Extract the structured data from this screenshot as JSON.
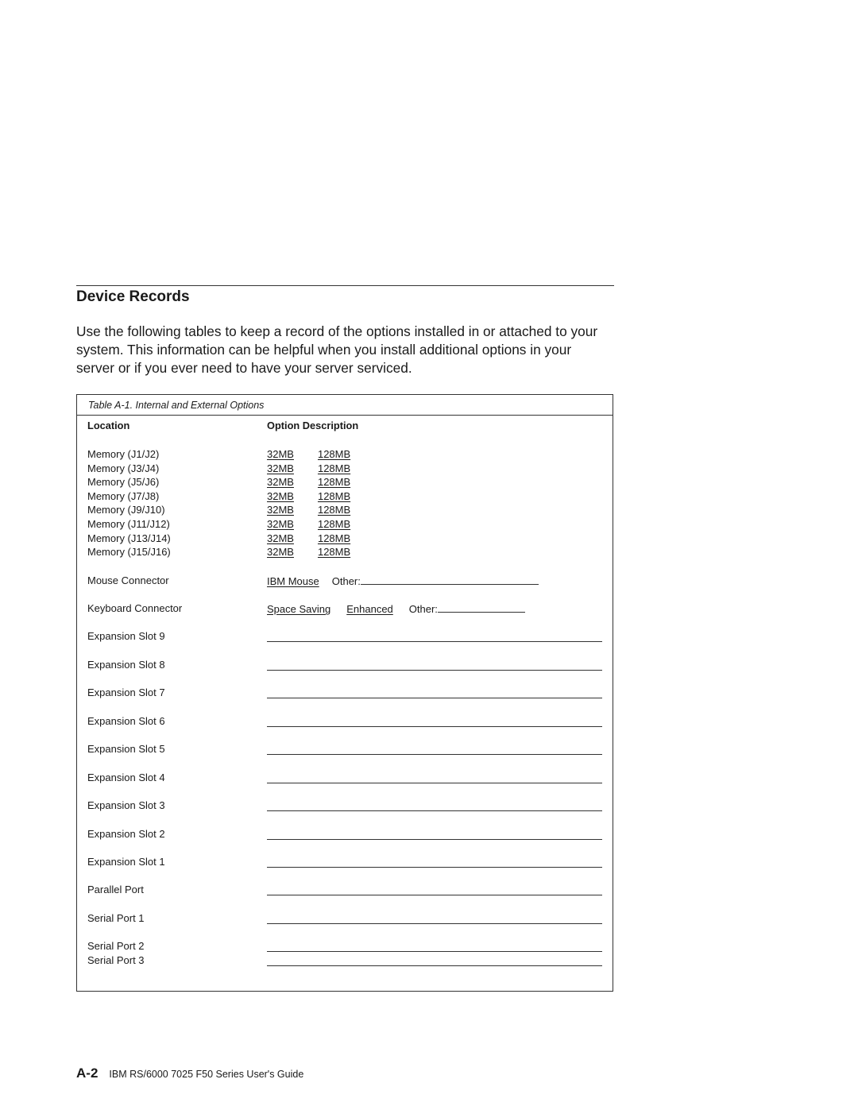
{
  "section": {
    "title": "Device Records",
    "intro": "Use the following tables to keep a record of the options installed in or attached to your system.  This information can be helpful when you install additional options in your server or if you ever need to have your server serviced."
  },
  "table": {
    "caption": "Table   A-1.  Internal and External Options",
    "headers": {
      "location": "Location",
      "description": "Option Description"
    },
    "memory_rows": [
      {
        "location": "Memory (J1/J2)",
        "options": [
          "32MB",
          "128MB"
        ]
      },
      {
        "location": "Memory (J3/J4)",
        "options": [
          "32MB",
          "128MB"
        ]
      },
      {
        "location": "Memory (J5/J6)",
        "options": [
          "32MB",
          "128MB"
        ]
      },
      {
        "location": "Memory (J7/J8)",
        "options": [
          "32MB",
          "128MB"
        ]
      },
      {
        "location": "Memory (J9/J10)",
        "options": [
          "32MB",
          "128MB"
        ]
      },
      {
        "location": "Memory (J11/J12)",
        "options": [
          "32MB",
          "128MB"
        ]
      },
      {
        "location": "Memory (J13/J14)",
        "options": [
          "32MB",
          "128MB"
        ]
      },
      {
        "location": "Memory (J15/J16)",
        "options": [
          "32MB",
          "128MB"
        ]
      }
    ],
    "mouse": {
      "location": "Mouse Connector",
      "option": "IBM Mouse",
      "other_label": "Other:"
    },
    "keyboard": {
      "location": "Keyboard Connector",
      "options": [
        "Space Saving",
        "Enhanced"
      ],
      "other_label": "Other:"
    },
    "blank_rows": [
      {
        "location": "Expansion Slot 9"
      },
      {
        "location": "Expansion Slot 8"
      },
      {
        "location": "Expansion Slot 7"
      },
      {
        "location": "Expansion Slot 6"
      },
      {
        "location": "Expansion Slot 5"
      },
      {
        "location": "Expansion Slot 4"
      },
      {
        "location": "Expansion Slot 3"
      },
      {
        "location": "Expansion Slot 2"
      },
      {
        "location": "Expansion Slot 1"
      },
      {
        "location": "Parallel Port"
      },
      {
        "location": "Serial Port 1"
      },
      {
        "location": "Serial Port 2"
      },
      {
        "location": "Serial Port 3"
      }
    ]
  },
  "footer": {
    "page_number": "A-2",
    "book_title": "IBM RS/6000 7025 F50 Series User's Guide"
  }
}
